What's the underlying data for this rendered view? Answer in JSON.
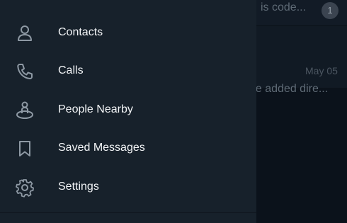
{
  "background_chat": {
    "row1_preview": "is code...",
    "row1_unread": "1",
    "row2_date": "May 05",
    "row2_preview": "be added dire..."
  },
  "drawer": {
    "items": [
      {
        "label": "Contacts",
        "icon": "person-icon"
      },
      {
        "label": "Calls",
        "icon": "phone-icon"
      },
      {
        "label": "People Nearby",
        "icon": "people-nearby-icon"
      },
      {
        "label": "Saved Messages",
        "icon": "bookmark-icon"
      },
      {
        "label": "Settings",
        "icon": "gear-icon"
      }
    ]
  },
  "colors": {
    "drawer_bg": "#17212b",
    "text": "#f3f5f7",
    "icon": "#8e99a4"
  }
}
